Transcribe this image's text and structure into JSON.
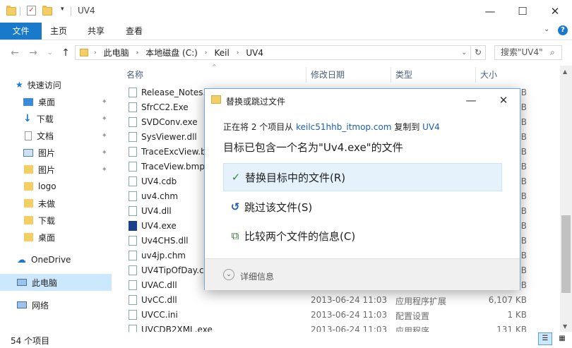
{
  "window": {
    "title": "UV4"
  },
  "ribbon": {
    "tabs": [
      "文件",
      "主页",
      "共享",
      "查看"
    ]
  },
  "address": {
    "path": [
      "此电脑",
      "本地磁盘 (C:)",
      "Keil",
      "UV4"
    ],
    "search_placeholder": "搜索\"UV4\""
  },
  "nav": {
    "quick_access": "快速访问",
    "items": [
      "桌面",
      "下载",
      "文档",
      "图片",
      "图片",
      "logo",
      "未做",
      "下载",
      "桌面"
    ],
    "onedrive": "OneDrive",
    "this_pc": "此电脑",
    "network": "网络"
  },
  "columns": {
    "name": "名称",
    "date": "修改日期",
    "type": "类型",
    "size": "大小"
  },
  "files": [
    {
      "name": "Release_Notes.h",
      "date": "",
      "type": "",
      "size": "B"
    },
    {
      "name": "SfrCC2.Exe",
      "date": "",
      "type": "",
      "size": "B"
    },
    {
      "name": "SVDConv.exe",
      "date": "",
      "type": "",
      "size": "B"
    },
    {
      "name": "SysViewer.dll",
      "date": "",
      "type": "",
      "size": "B"
    },
    {
      "name": "TraceExcView.b",
      "date": "",
      "type": "",
      "size": "B"
    },
    {
      "name": "TraceView.bmp",
      "date": "",
      "type": "",
      "size": "B"
    },
    {
      "name": "UV4.cdb",
      "date": "",
      "type": "",
      "size": "B"
    },
    {
      "name": "uv4.chm",
      "date": "",
      "type": "",
      "size": "B"
    },
    {
      "name": "UV4.dll",
      "date": "",
      "type": "",
      "size": "B"
    },
    {
      "name": "UV4.exe",
      "date": "",
      "type": "",
      "size": "B"
    },
    {
      "name": "Uv4CHS.dll",
      "date": "",
      "type": "",
      "size": "B"
    },
    {
      "name": "uv4jp.chm",
      "date": "",
      "type": "",
      "size": "B"
    },
    {
      "name": "UV4TipOfDay.c",
      "date": "",
      "type": "",
      "size": "B"
    },
    {
      "name": "UVAC.dll",
      "date": "",
      "type": "",
      "size": "B"
    },
    {
      "name": "UvCC.dll",
      "date": "2013-06-24 11:03",
      "type": "应用程序扩展",
      "size": "6,107 KB"
    },
    {
      "name": "UVCC.ini",
      "date": "2013-06-24 11:03",
      "type": "配置设置",
      "size": "1 KB"
    },
    {
      "name": "UVCDB2XML.exe",
      "date": "2013-06-24 11:03",
      "type": "应用程序",
      "size": "131 KB"
    }
  ],
  "status": {
    "count": "54 个项目"
  },
  "dialog": {
    "title": "替换或跳过文件",
    "copy_prefix": "正在将 2 个项目从",
    "source": "keilc51hhb_itmop.com",
    "copy_mid": "复制到",
    "dest": "UV4",
    "message": "目标已包含一个名为\"Uv4.exe\"的文件",
    "options": [
      "替换目标中的文件(R)",
      "跳过该文件(S)",
      "比较两个文件的信息(C)"
    ],
    "details": "详细信息"
  }
}
